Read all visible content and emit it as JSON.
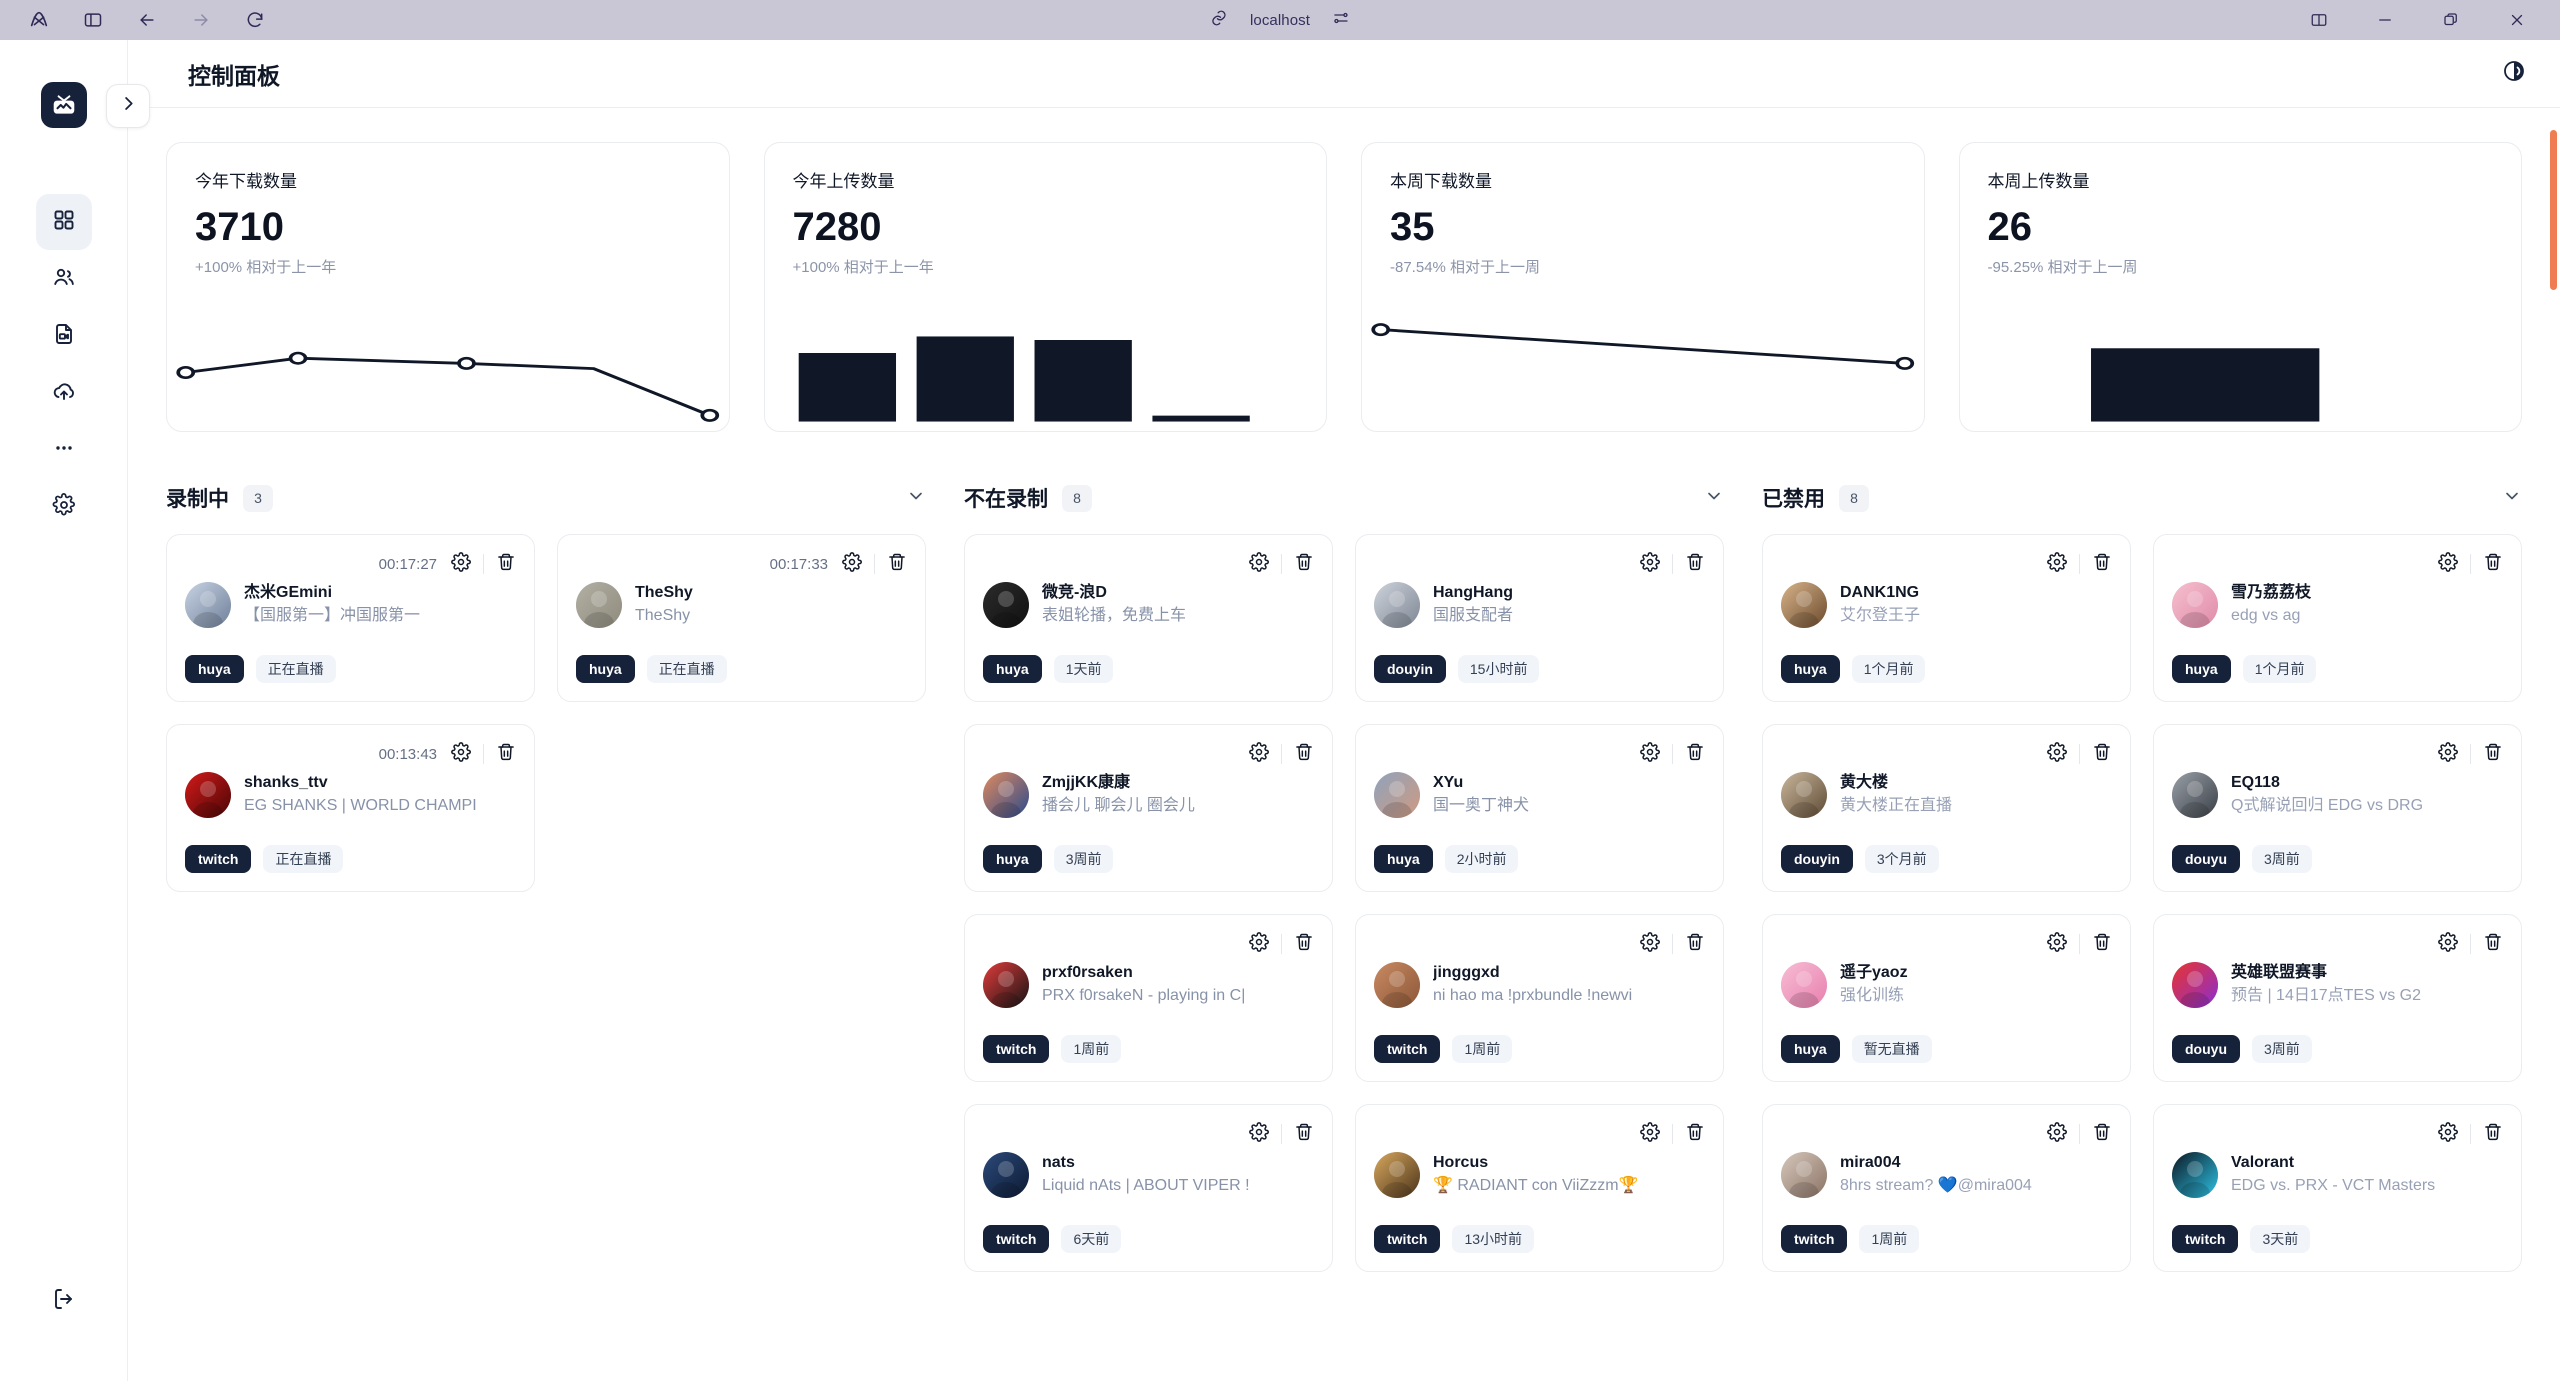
{
  "browser": {
    "url": "localhost",
    "icons": {
      "arc_logo": "arc-logo-icon",
      "sidebar_toggle": "sidebar-toggle-icon",
      "back": "back-arrow-icon",
      "forward": "forward-arrow-icon",
      "reload": "reload-icon",
      "link": "link-icon",
      "tune": "tune-sliders-icon",
      "split": "split-view-icon",
      "minimize": "minimize-icon",
      "maximize": "maximize-icon",
      "close": "close-icon"
    }
  },
  "rail": {
    "logo": "tv-activity-logo",
    "items": [
      {
        "name": "dashboard",
        "icon": "grid-icon",
        "active": true
      },
      {
        "name": "streamers",
        "icon": "users-icon",
        "active": false
      },
      {
        "name": "recordings",
        "icon": "file-video-icon",
        "active": false
      },
      {
        "name": "uploads",
        "icon": "cloud-upload-icon",
        "active": false
      },
      {
        "name": "more",
        "icon": "ellipsis-icon",
        "active": false
      },
      {
        "name": "settings",
        "icon": "gear-icon",
        "active": false
      }
    ],
    "bottom": {
      "name": "logout",
      "icon": "logout-icon"
    }
  },
  "topbar": {
    "title": "控制面板",
    "collapse_icon": "chevron-right-icon",
    "theme_icon": "moon-theme-icon"
  },
  "stats": [
    {
      "label": "今年下载数量",
      "value": "3710",
      "delta": "+100% 相对于上一年",
      "chart": {
        "type": "line",
        "points": [
          [
            0,
            38
          ],
          [
            32,
            24
          ],
          [
            57,
            27
          ],
          [
            75,
            50
          ],
          [
            100,
            82
          ]
        ]
      }
    },
    {
      "label": "今年上传数量",
      "value": "7280",
      "delta": "+100% 相对于上一年",
      "chart": {
        "type": "bar",
        "values": [
          52,
          74,
          68,
          4
        ]
      }
    },
    {
      "label": "本周下载数量",
      "value": "35",
      "delta": "-87.54% 相对于上一周",
      "chart": {
        "type": "line",
        "points": [
          [
            0,
            18
          ],
          [
            100,
            44
          ]
        ]
      }
    },
    {
      "label": "本周上传数量",
      "value": "26",
      "delta": "-95.25% 相对于上一周",
      "chart": {
        "type": "bar",
        "values": [
          0,
          0,
          58,
          0
        ]
      }
    }
  ],
  "chart_data": [
    {
      "type": "line",
      "title": "今年下载数量",
      "x": [
        "1",
        "2",
        "3",
        "4",
        "5"
      ],
      "values": [
        62,
        76,
        73,
        50,
        18
      ],
      "ylabel": "下载数量",
      "xlabel": "",
      "grid": false,
      "legend": "none"
    },
    {
      "type": "bar",
      "title": "今年上传数量",
      "categories": [
        "1",
        "2",
        "3",
        "4"
      ],
      "values": [
        52,
        74,
        68,
        4
      ],
      "ylabel": "上传数量",
      "xlabel": "",
      "grid": false,
      "legend": "none"
    },
    {
      "type": "line",
      "title": "本周下载数量",
      "x": [
        "1",
        "2"
      ],
      "values": [
        82,
        56
      ],
      "ylabel": "下载数量",
      "xlabel": "",
      "grid": false,
      "legend": "none"
    },
    {
      "type": "bar",
      "title": "本周上传数量",
      "categories": [
        "1",
        "2",
        "3",
        "4"
      ],
      "values": [
        0,
        0,
        58,
        0
      ],
      "ylabel": "上传数量",
      "xlabel": "",
      "grid": false,
      "legend": "none"
    }
  ],
  "sections": [
    {
      "title": "录制中",
      "count": "3",
      "cards": [
        {
          "timer": "00:17:27",
          "name": "杰米GEmini",
          "desc": "【国服第一】冲国服第一",
          "platform": "huya",
          "status": "正在直播",
          "avatar_colors": [
            "#c9d4e4",
            "#6e7f99"
          ]
        },
        {
          "timer": "00:17:33",
          "name": "TheShy",
          "desc": "TheShy",
          "platform": "huya",
          "status": "正在直播",
          "avatar_colors": [
            "#b3b0a4",
            "#8e8b7d"
          ]
        },
        {
          "timer": "00:13:43",
          "name": "shanks_ttv",
          "desc": "EG SHANKS | WORLD CHAMPI",
          "platform": "twitch",
          "status": "正在直播",
          "avatar_colors": [
            "#d41a1a",
            "#4a0505"
          ]
        }
      ]
    },
    {
      "title": "不在录制",
      "count": "8",
      "cards": [
        {
          "timer": "",
          "name": "微竞-浪D",
          "desc": "表姐轮播，免费上车",
          "platform": "huya",
          "status": "1天前",
          "avatar_colors": [
            "#2b2b2b",
            "#111111"
          ]
        },
        {
          "timer": "",
          "name": "HangHang",
          "desc": "国服支配者",
          "platform": "douyin",
          "status": "15小时前",
          "avatar_colors": [
            "#cfd4db",
            "#7d8694"
          ]
        },
        {
          "timer": "",
          "name": "ZmjjKK康康",
          "desc": "播会儿 聊会儿 圈会儿",
          "platform": "huya",
          "status": "3周前",
          "avatar_colors": [
            "#e08a5e",
            "#2b4a8c"
          ]
        },
        {
          "timer": "",
          "name": "XYu",
          "desc": "国一奥丁神犬",
          "platform": "huya",
          "status": "2小时前",
          "avatar_colors": [
            "#8fa3bd",
            "#cf9a80"
          ]
        },
        {
          "timer": "",
          "name": "prxf0rsaken",
          "desc": "PRX f0rsakeN - playing in C|",
          "platform": "twitch",
          "status": "1周前",
          "avatar_colors": [
            "#e23b3b",
            "#141414"
          ]
        },
        {
          "timer": "",
          "name": "jingggxd",
          "desc": "ni hao ma !prxbundle !newvi",
          "platform": "twitch",
          "status": "1周前",
          "avatar_colors": [
            "#c98a63",
            "#8c5737"
          ]
        },
        {
          "timer": "",
          "name": "nats",
          "desc": "Liquid nAts | ABOUT VIPER !",
          "platform": "twitch",
          "status": "6天前",
          "avatar_colors": [
            "#2b4a7a",
            "#0d1a33"
          ]
        },
        {
          "timer": "",
          "name": "Horcus",
          "desc": "🏆 RADIANT con ViiZzzm🏆",
          "platform": "twitch",
          "status": "13小时前",
          "avatar_colors": [
            "#d8a85f",
            "#4a3319"
          ]
        }
      ]
    },
    {
      "title": "已禁用",
      "count": "8",
      "cards": [
        {
          "timer": "",
          "name": "DANK1NG",
          "desc": "艾尔登王子",
          "platform": "huya",
          "status": "1个月前",
          "avatar_colors": [
            "#d8b48a",
            "#6b4a2d"
          ]
        },
        {
          "timer": "",
          "name": "雪乃荔荔枝",
          "desc": "edg vs ag",
          "platform": "huya",
          "status": "1个月前",
          "avatar_colors": [
            "#f5c0cf",
            "#e08aa8"
          ]
        },
        {
          "timer": "",
          "name": "黄大楼",
          "desc": "黄大楼正在直播",
          "platform": "douyin",
          "status": "3个月前",
          "avatar_colors": [
            "#c9b79d",
            "#5e4a33"
          ]
        },
        {
          "timer": "",
          "name": "EQ118",
          "desc": "Q式解说回归 EDG vs DRG",
          "platform": "douyu",
          "status": "3周前",
          "avatar_colors": [
            "#9aa0a8",
            "#3a3f46"
          ]
        },
        {
          "timer": "",
          "name": "遥子yaoz",
          "desc": "强化训练",
          "platform": "huya",
          "status": "暂无直播",
          "avatar_colors": [
            "#f7bdd4",
            "#e87fae"
          ]
        },
        {
          "timer": "",
          "name": "英雄联盟赛事",
          "desc": "预告 | 14日17点TES vs G2",
          "platform": "douyu",
          "status": "3周前",
          "avatar_colors": [
            "#e8342d",
            "#8b2fd1"
          ]
        },
        {
          "timer": "",
          "name": "mira004",
          "desc": "8hrs stream? 💙@mira004",
          "platform": "twitch",
          "status": "1周前",
          "avatar_colors": [
            "#d6c8bc",
            "#8a7264"
          ]
        },
        {
          "timer": "",
          "name": "Valorant",
          "desc": "EDG vs. PRX - VCT Masters",
          "platform": "twitch",
          "status": "3天前",
          "avatar_colors": [
            "#0b1622",
            "#2ec4e6"
          ]
        }
      ]
    }
  ],
  "icons": {
    "gear": "gear-icon",
    "trash": "trash-icon",
    "chevron_down": "chevron-down-icon"
  }
}
